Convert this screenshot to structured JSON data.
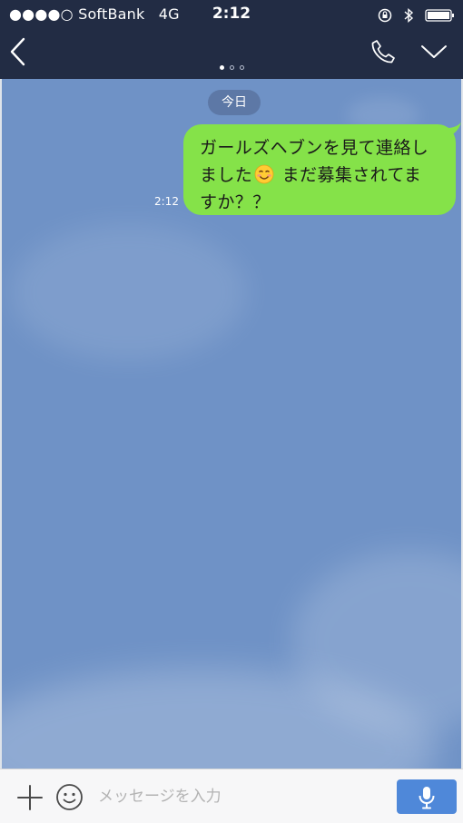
{
  "status_bar": {
    "carrier": "●●●●○ SoftBank",
    "network": "4G",
    "time": "2:12",
    "icons": [
      "rotation-lock-icon",
      "bluetooth-icon",
      "battery-icon"
    ]
  },
  "nav_bar": {
    "icons": [
      "back-chevron-icon",
      "phone-icon",
      "chevron-down-icon"
    ],
    "page_indicator": {
      "count": 3,
      "active_index": 0
    }
  },
  "chat": {
    "date_label": "今日",
    "messages": [
      {
        "direction": "outgoing",
        "line1": "ガールズヘブンを見て連絡し",
        "line2_before_emoji": "ました",
        "emoji": "smiling-face-emoji",
        "line2_after_emoji": " まだ募集されてま",
        "line3": "すか？？",
        "time": "2:12"
      }
    ]
  },
  "input_bar": {
    "placeholder": "メッセージを入力",
    "value": "",
    "icons": [
      "plus-icon",
      "emoji-icon",
      "microphone-icon"
    ]
  },
  "colors": {
    "header_bg": "#222c44",
    "chat_bg": "#6f92c6",
    "bubble_green": "#85e249",
    "mic_button": "#4f88d9",
    "date_pill": "#5d78a6"
  }
}
